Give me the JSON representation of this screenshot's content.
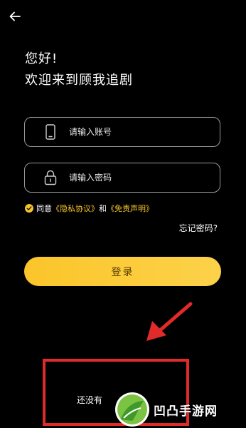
{
  "header": {
    "back_icon": "arrow-left-icon"
  },
  "greeting": {
    "line1": "您好!",
    "line2": "欢迎来到顾我追剧"
  },
  "form": {
    "account": {
      "icon": "phone-icon",
      "placeholder": "请输入账号",
      "value": ""
    },
    "password": {
      "icon": "lock-icon",
      "placeholder": "请输入密码",
      "value": ""
    }
  },
  "agreement": {
    "checked": true,
    "prefix": "同意",
    "privacy_link": "《隐私协议》",
    "connector": "和",
    "disclaimer_link": "《免责声明》"
  },
  "forgot_password": "忘记密码?",
  "login_button": "登录",
  "register_prompt": "还没有",
  "watermark": {
    "text": "凹凸手游网"
  },
  "colors": {
    "background": "#000000",
    "accent": "#f5c32c",
    "annotation": "#e12a2a"
  }
}
